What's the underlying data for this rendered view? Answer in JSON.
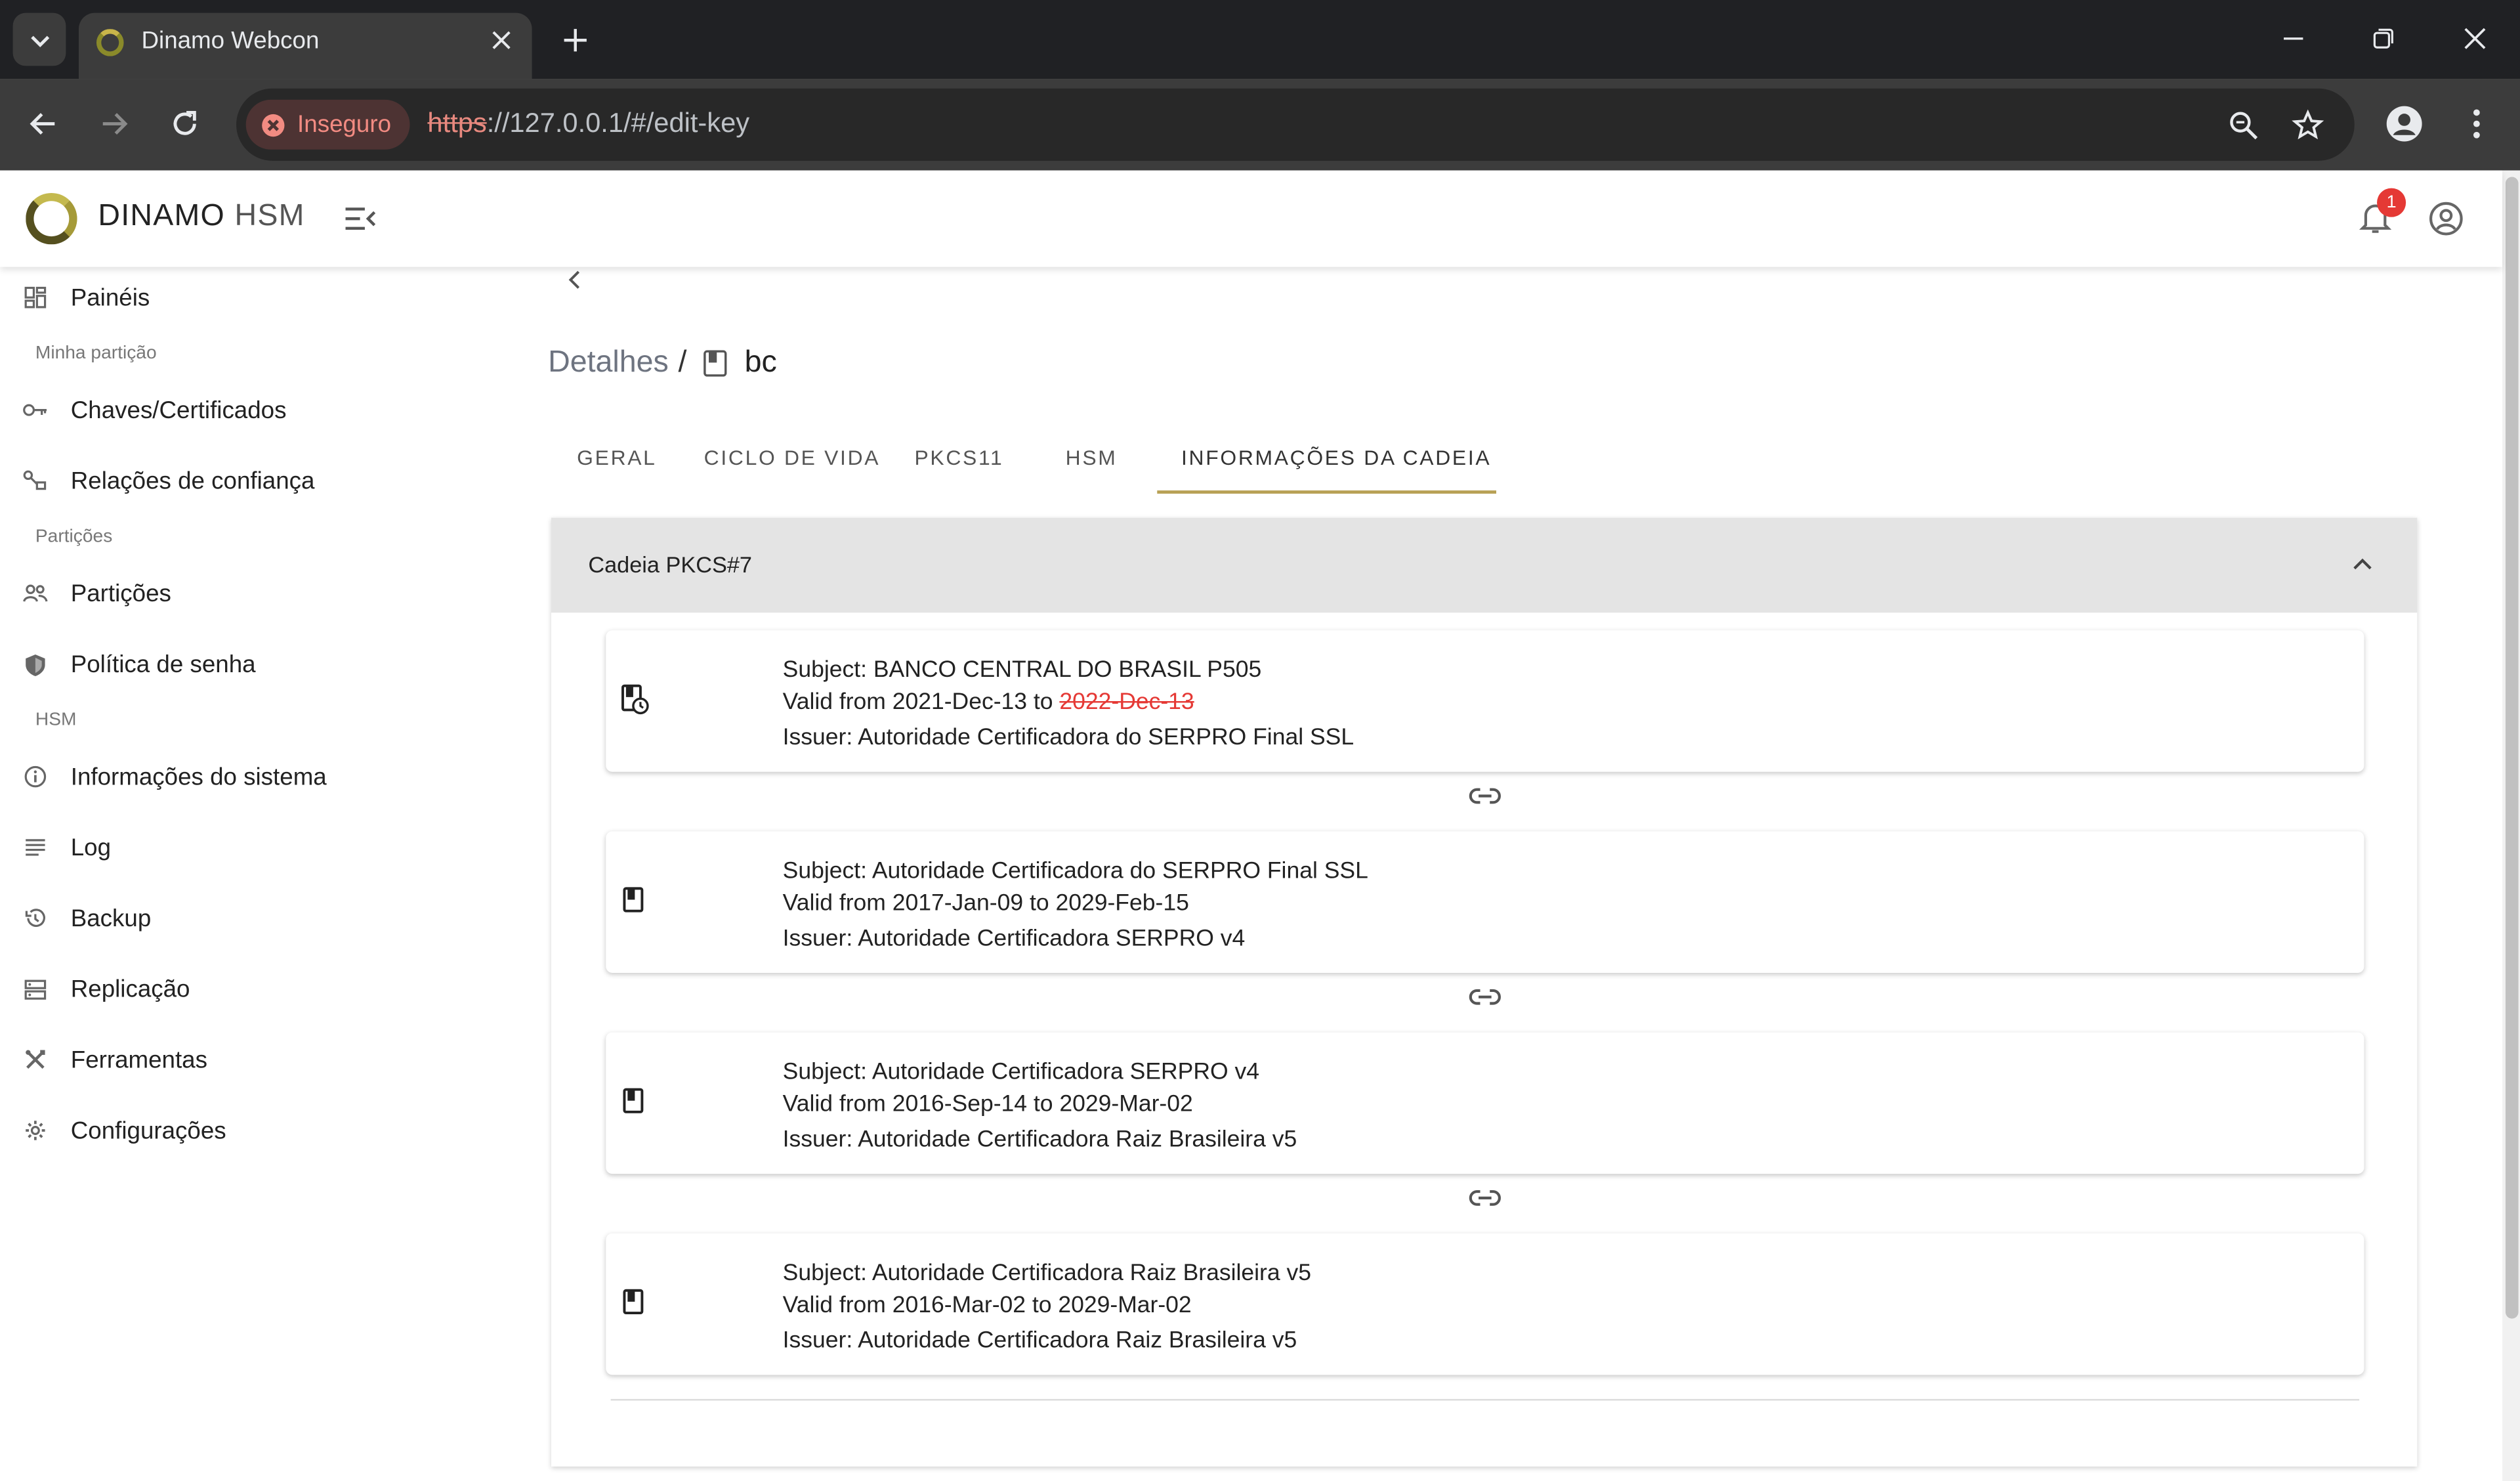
{
  "browser": {
    "tab_title": "Dinamo Webcon",
    "security_label": "Inseguro",
    "url_scheme": "https",
    "url_rest": "://127.0.0.1/#/edit-key"
  },
  "header": {
    "brand": "DINAMO",
    "brand_suffix": "HSM",
    "notification_count": "1"
  },
  "sidebar": {
    "items": [
      {
        "label": "Painéis",
        "icon": "dashboard-icon"
      },
      {
        "section": "Minha partição"
      },
      {
        "label": "Chaves/Certificados",
        "icon": "key-icon"
      },
      {
        "label": "Relações de confiança",
        "icon": "trust-icon"
      },
      {
        "section": "Partições"
      },
      {
        "label": "Partições",
        "icon": "people-icon"
      },
      {
        "label": "Política de senha",
        "icon": "shield-icon"
      },
      {
        "section": "HSM"
      },
      {
        "label": "Informações do sistema",
        "icon": "info-icon"
      },
      {
        "label": "Log",
        "icon": "list-icon"
      },
      {
        "label": "Backup",
        "icon": "history-icon"
      },
      {
        "label": "Replicação",
        "icon": "storage-icon"
      },
      {
        "label": "Ferramentas",
        "icon": "tools-icon"
      },
      {
        "label": "Configurações",
        "icon": "gear-icon"
      }
    ]
  },
  "page": {
    "breadcrumb_parent": "Detalhes",
    "breadcrumb_sep": "/",
    "breadcrumb_current": "bc",
    "tabs": [
      "GERAL",
      "CICLO DE VIDA",
      "PKCS11",
      "HSM",
      "INFORMAÇÕES DA CADEIA"
    ],
    "active_tab": "INFORMAÇÕES DA CADEIA"
  },
  "chain": {
    "title": "Cadeia PKCS#7",
    "certificates": [
      {
        "subject": "Subject: BANCO CENTRAL DO BRASIL P505",
        "valid_prefix": "Valid from 2021-Dec-13 to ",
        "valid_to": "2022-Dec-13",
        "expired": true,
        "issuer": "Issuer: Autoridade Certificadora do SERPRO Final SSL"
      },
      {
        "subject": "Subject: Autoridade Certificadora do SERPRO Final SSL",
        "valid_prefix": "Valid from 2017-Jan-09 to ",
        "valid_to": "2029-Feb-15",
        "expired": false,
        "issuer": "Issuer: Autoridade Certificadora SERPRO v4"
      },
      {
        "subject": "Subject: Autoridade Certificadora SERPRO v4",
        "valid_prefix": "Valid from 2016-Sep-14 to ",
        "valid_to": "2029-Mar-02",
        "expired": false,
        "issuer": "Issuer: Autoridade Certificadora Raiz Brasileira v5"
      },
      {
        "subject": "Subject: Autoridade Certificadora Raiz Brasileira v5",
        "valid_prefix": "Valid from 2016-Mar-02 to ",
        "valid_to": "2029-Mar-02",
        "expired": false,
        "issuer": "Issuer: Autoridade Certificadora Raiz Brasileira v5"
      }
    ]
  },
  "colors": {
    "accent": "#b8a156",
    "expired": "#e53935",
    "badge": "#e53935"
  }
}
